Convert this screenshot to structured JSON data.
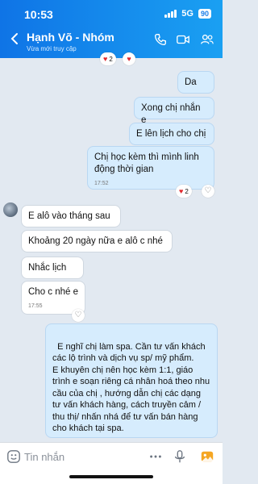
{
  "status": {
    "time": "10:53",
    "network": "5G",
    "battery": "90"
  },
  "header": {
    "title": "Hạnh Võ - Nhóm",
    "subtitle": "Vừa mới truy cập"
  },
  "top_reaction": {
    "count": "2"
  },
  "messages": {
    "m1": "Da",
    "m2": "Xong chị nhắn e",
    "m3": "E lên lịch cho chị",
    "m4": "Chị học kèm thì mình linh động thời gian",
    "m4_time": "17:52",
    "m4_react_count": "2",
    "m5": "E alô vào tháng sau",
    "m6": "Khoảng 20 ngày nữa e alô c nhé",
    "m7": "Nhắc lịch",
    "m8": "Cho c nhé e",
    "m8_time": "17:55",
    "m9": "E nghĩ chị làm spa. Cần tư vấn khách các lộ trình và dịch vụ sp/ mỹ phẩm.\nE khuyên chị nên học kèm 1:1, giáo trình e soạn riêng cá nhân hoá theo nhu cầu của chị , hướng dẫn chị các dạng tư vấn khách hàng, cách truyền cảm / thu thị/ nhấn nhá để tư vấn bán hàng cho khách tại spa."
  },
  "composer": {
    "placeholder": "Tin nhắn"
  },
  "icons": {
    "back": "chevron-left-icon",
    "call": "phone-icon",
    "video": "video-icon",
    "group": "group-icon",
    "menu": "menu-icon",
    "sticker": "sticker-icon",
    "more": "more-icon",
    "mic": "microphone-icon",
    "image": "image-icon"
  },
  "colors": {
    "header": "#1a8ae8",
    "mine_bubble": "#d6ecfd",
    "background": "#e2e9f1",
    "heart": "#e0282e"
  }
}
